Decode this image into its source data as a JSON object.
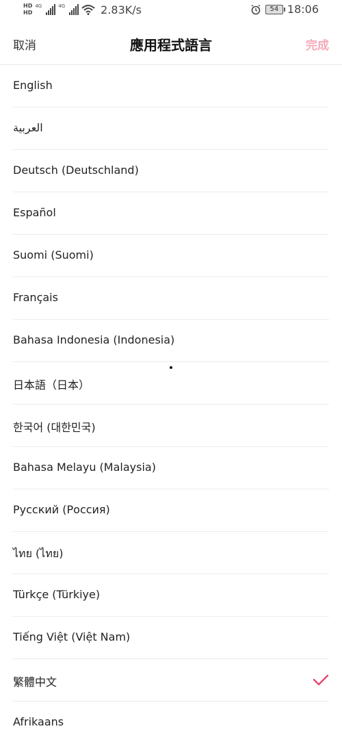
{
  "status_bar": {
    "hd1": "HD",
    "hd2": "HD",
    "net1": "4G",
    "net2": "4G",
    "speed": "2.83K/s",
    "battery": "54",
    "time": "18:06",
    "icons": [
      "signal-icon",
      "wifi-icon",
      "alarm-icon",
      "battery-icon"
    ]
  },
  "header": {
    "cancel_label": "取消",
    "title": "應用程式語言",
    "done_label": "完成"
  },
  "languages": [
    {
      "label": "English",
      "selected": false
    },
    {
      "label": "العربية",
      "selected": false
    },
    {
      "label": "Deutsch (Deutschland)",
      "selected": false
    },
    {
      "label": "Español",
      "selected": false
    },
    {
      "label": "Suomi (Suomi)",
      "selected": false
    },
    {
      "label": "Français",
      "selected": false
    },
    {
      "label": "Bahasa Indonesia (Indonesia)",
      "selected": false
    },
    {
      "label": "日本語（日本）",
      "selected": false
    },
    {
      "label": "한국어 (대한민국)",
      "selected": false
    },
    {
      "label": "Bahasa Melayu (Malaysia)",
      "selected": false
    },
    {
      "label": "Русский (Россия)",
      "selected": false
    },
    {
      "label": "ไทย (ไทย)",
      "selected": false
    },
    {
      "label": "Türkçe (Türkiye)",
      "selected": false
    },
    {
      "label": "Tiếng Việt (Việt Nam)",
      "selected": false
    },
    {
      "label": "繁體中文",
      "selected": true
    },
    {
      "label": "Afrikaans",
      "selected": false
    }
  ],
  "colors": {
    "accent": "#e8436b",
    "done_disabled": "#f6a9b9"
  }
}
